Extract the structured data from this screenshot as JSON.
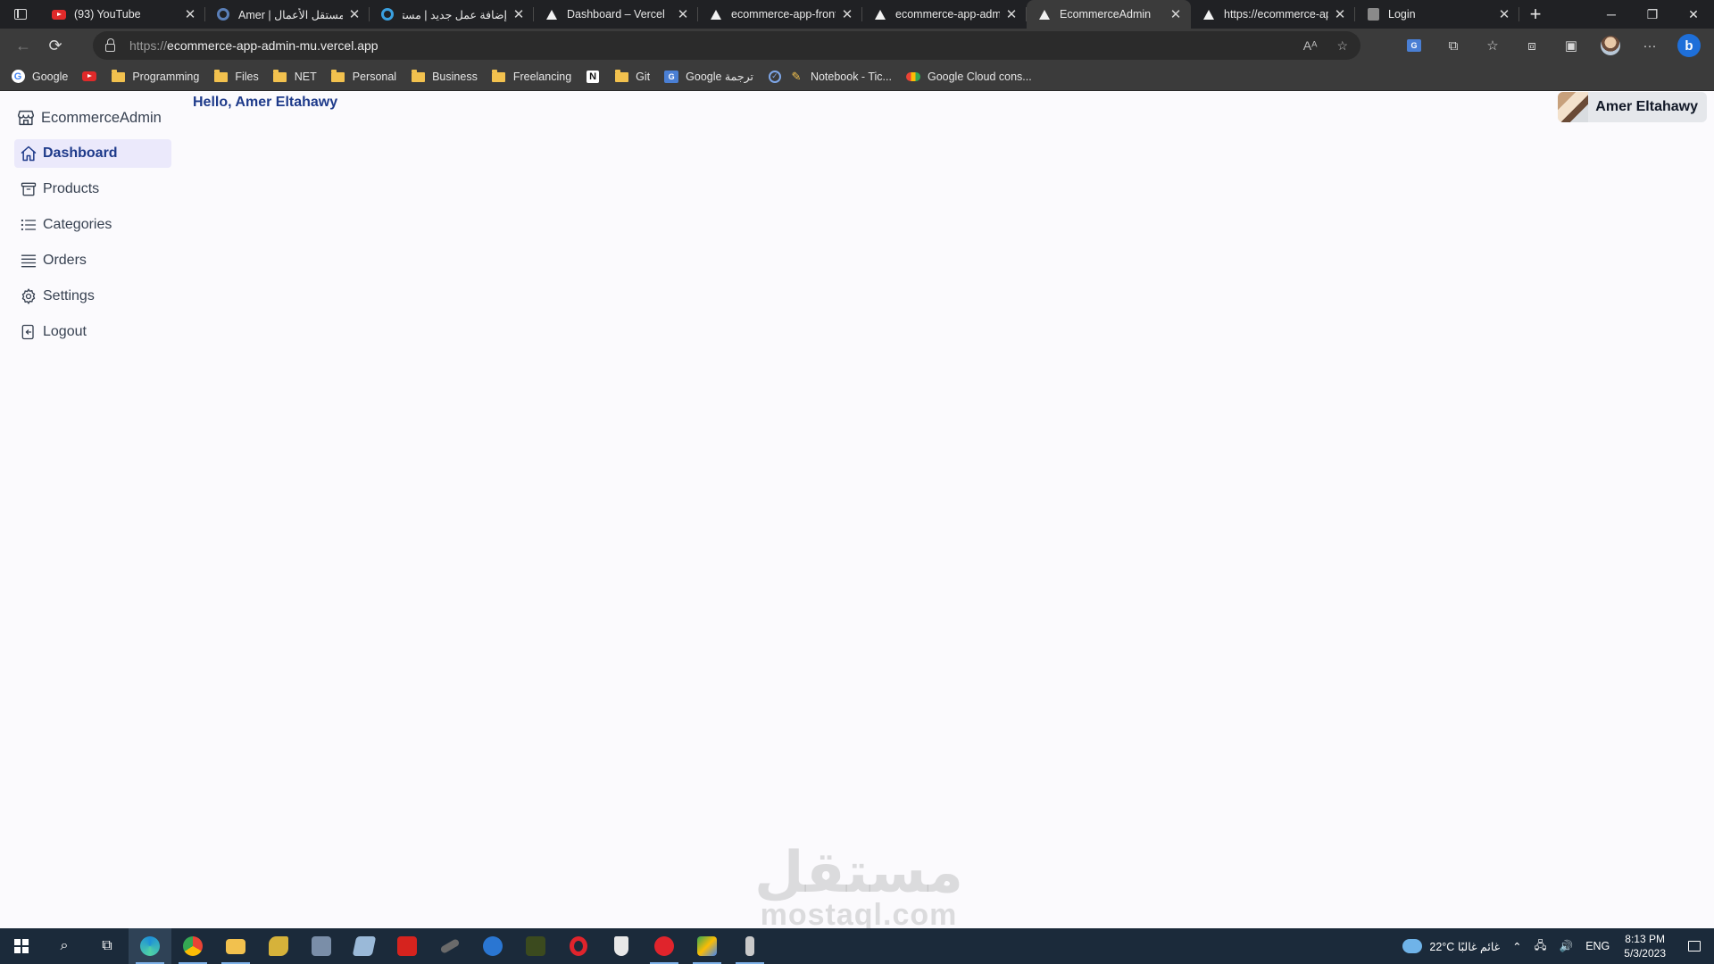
{
  "browser": {
    "tabs": [
      {
        "title": "(93) YouTube",
        "icon": "youtube-icon"
      },
      {
        "title": "Amer | مستقل الأعمال",
        "icon": "mostaql-icon"
      },
      {
        "title": "إضافة عمل جديد | مستقل",
        "icon": "mostaql-icon"
      },
      {
        "title": "Dashboard – Vercel",
        "icon": "vercel-icon"
      },
      {
        "title": "ecommerce-app-front",
        "icon": "vercel-icon"
      },
      {
        "title": "ecommerce-app-admi",
        "icon": "vercel-icon"
      },
      {
        "title": "EcommerceAdmin",
        "icon": "vercel-icon",
        "active": true
      },
      {
        "title": "https://ecommerce-ap",
        "icon": "vercel-icon"
      },
      {
        "title": "Login",
        "icon": "page-icon"
      }
    ],
    "address": {
      "scheme": "https://",
      "host": "ecommerce-app-admin-mu.vercel.app"
    },
    "bookmarks": [
      {
        "label": "Google",
        "icon": "google-icon"
      },
      {
        "label": "",
        "icon": "youtube-icon"
      },
      {
        "label": "Programming",
        "icon": "folder-icon"
      },
      {
        "label": "Files",
        "icon": "folder-icon"
      },
      {
        "label": "NET",
        "icon": "folder-icon"
      },
      {
        "label": "Personal",
        "icon": "folder-icon"
      },
      {
        "label": "Business",
        "icon": "folder-icon"
      },
      {
        "label": "Freelancing",
        "icon": "folder-icon"
      },
      {
        "label": "",
        "icon": "notion-icon"
      },
      {
        "label": "Git",
        "icon": "folder-icon"
      },
      {
        "label": "Google ترجمة",
        "icon": "translate-icon"
      },
      {
        "label": "",
        "icon": "check-icon"
      },
      {
        "label": "Notebook - Tic...",
        "icon": "pen-icon"
      },
      {
        "label": "Google Cloud cons...",
        "icon": "cloud-icon"
      }
    ]
  },
  "app": {
    "brand": "EcommerceAdmin",
    "greeting_prefix": "Hello, ",
    "user_name": "Amer Eltahawy",
    "nav": [
      {
        "label": "Dashboard",
        "icon": "home-icon",
        "active": true
      },
      {
        "label": "Products",
        "icon": "archive-box-icon"
      },
      {
        "label": "Categories",
        "icon": "list-icon"
      },
      {
        "label": "Orders",
        "icon": "queue-list-icon"
      },
      {
        "label": "Settings",
        "icon": "gear-icon"
      },
      {
        "label": "Logout",
        "icon": "logout-icon"
      }
    ],
    "accent_color": "#1e3a8a",
    "active_bg_color": "#ebe9fb"
  },
  "watermark": {
    "top": "مستقل",
    "bottom": "mostaql.com"
  },
  "taskbar": {
    "weather": "22°C  غائم غالبًا",
    "language": "ENG",
    "time": "8:13 PM",
    "date": "5/3/2023"
  }
}
